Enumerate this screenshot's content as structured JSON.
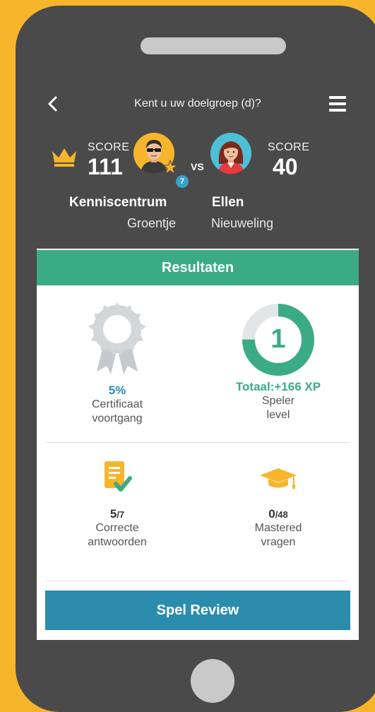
{
  "header": {
    "title": "Kent u uw doelgroep (d)?"
  },
  "player1": {
    "score_label": "SCORE",
    "score": "111",
    "name": "Kenniscentrum",
    "rank": "Groentje",
    "level_badge": "7"
  },
  "vs_label": "VS",
  "player2": {
    "score_label": "SCORE",
    "score": "40",
    "name": "Ellen",
    "rank": "Nieuweling"
  },
  "results": {
    "title": "Resultaten",
    "certificate": {
      "value": "5%",
      "label_line1": "Certificaat",
      "label_line2": "voortgang"
    },
    "level": {
      "number": "1",
      "value": "Totaal:+166 XP",
      "label_line1": "Speler",
      "label_line2": "level",
      "progress": 0.75
    },
    "correct": {
      "value": "5",
      "total": "/7",
      "label_line1": "Correcte",
      "label_line2": "antwoorden"
    },
    "mastered": {
      "value": "0",
      "total": "/48",
      "label_line1": "Mastered",
      "label_line2": "vragen"
    }
  },
  "review_button": "Spel Review",
  "colors": {
    "background": "#f7b52c",
    "phone": "#4a4a4a",
    "green": "#3aab85",
    "blue": "#2b8cad",
    "badge": "#3aa0c9",
    "gold": "#f7b52c"
  },
  "icons": {
    "back": "chevron-left-icon",
    "menu": "hamburger-menu-icon",
    "crown": "crown-icon",
    "certificate": "award-ribbon-icon",
    "correct": "checked-document-icon",
    "mastered": "graduation-cap-icon"
  }
}
